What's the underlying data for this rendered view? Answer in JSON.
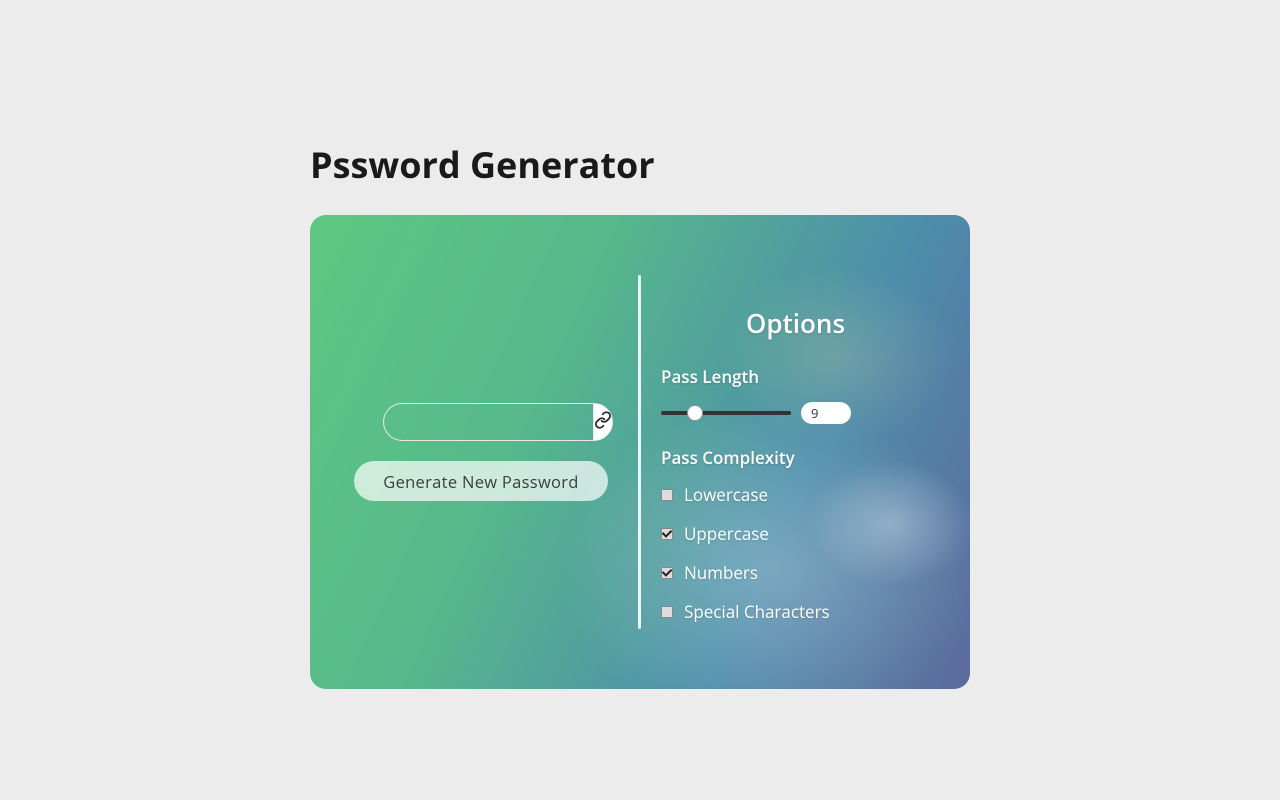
{
  "title": "Pssword Generator",
  "output": {
    "value": "",
    "placeholder": ""
  },
  "generate_label": "Generate New Password",
  "options": {
    "title": "Options",
    "pass_length_label": "Pass Length",
    "pass_length_value": "9",
    "pass_complexity_label": "Pass Complexity",
    "items": [
      {
        "label": "Lowercase",
        "checked": false
      },
      {
        "label": "Uppercase",
        "checked": true
      },
      {
        "label": "Numbers",
        "checked": true
      },
      {
        "label": "Special Characters",
        "checked": false
      }
    ]
  }
}
